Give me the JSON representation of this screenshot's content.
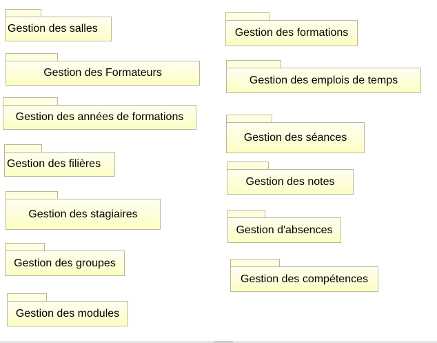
{
  "packages": [
    {
      "label": "Gestion des salles"
    },
    {
      "label": "Gestion des Formateurs"
    },
    {
      "label": "Gestion des années de formations"
    },
    {
      "label": "Gestion des filières"
    },
    {
      "label": "Gestion des stagiaires"
    },
    {
      "label": "Gestion des groupes"
    },
    {
      "label": "Gestion des modules"
    },
    {
      "label": "Gestion des formations"
    },
    {
      "label": "Gestion des emplois de temps"
    },
    {
      "label": "Gestion des séances"
    },
    {
      "label": "Gestion des notes"
    },
    {
      "label": "Gestion d'absences"
    },
    {
      "label": "Gestion des compétences"
    }
  ],
  "colors": {
    "package_fill": "#fdfdc4",
    "package_border": "#b8b89a"
  }
}
